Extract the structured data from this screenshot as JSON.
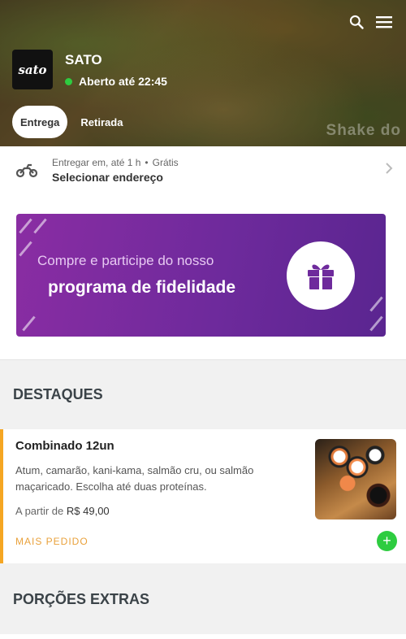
{
  "store": {
    "name": "SATO",
    "logo_text": "sato",
    "status": "Aberto até 22:45",
    "status_color": "#2ecc40"
  },
  "header": {
    "watermark": "Shake do",
    "icons": [
      "search-icon",
      "menu-icon"
    ]
  },
  "mode_tabs": [
    {
      "label": "Entrega",
      "active": true
    },
    {
      "label": "Retirada",
      "active": false
    }
  ],
  "delivery": {
    "prefix": "Entregar em, até 1 h",
    "fee": "Grátis",
    "address": "Selecionar endereço"
  },
  "banner": {
    "line1": "Compre e participe do nosso",
    "line2": "programa de fidelidade",
    "accent": "#7a2a9e"
  },
  "sections": [
    {
      "title": "DESTAQUES",
      "products": [
        {
          "name": "Combinado 12un",
          "description": "Atum, camarão, kani-kama, salmão cru, ou salmão maçaricado. Escolha até duas proteínas.",
          "price_prefix": "A partir de",
          "price": "R$ 49,00",
          "tag": "MAIS PEDIDO",
          "add_label": "+"
        }
      ]
    },
    {
      "title": "PORÇÕES EXTRAS"
    }
  ]
}
